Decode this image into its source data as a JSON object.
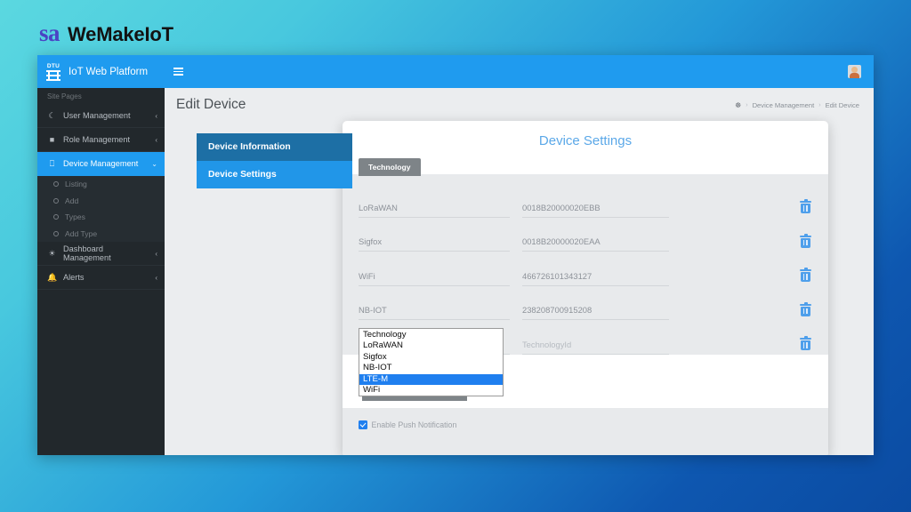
{
  "brand": {
    "prefix": "sa",
    "name": "WeMakeIoT"
  },
  "sidebar": {
    "logo_text": "DTU",
    "title": "IoT Web Platform",
    "section_label": "Site Pages",
    "items": [
      {
        "label": "User Management",
        "icon": "user-icon",
        "glyph": "●",
        "caret": "‹",
        "active": false
      },
      {
        "label": "Role Management",
        "icon": "id-card-icon",
        "glyph": "■",
        "caret": "‹",
        "active": false
      },
      {
        "label": "Device Management",
        "icon": "monitor-icon",
        "glyph": "▭",
        "caret": "⌄",
        "active": true
      },
      {
        "label": "Dashboard Management",
        "icon": "dashboard-icon",
        "glyph": "◔",
        "caret": "‹",
        "active": false
      },
      {
        "label": "Alerts",
        "icon": "bell-icon",
        "glyph": "▲",
        "caret": "‹",
        "active": false
      }
    ],
    "sub_items": [
      {
        "label": "Listing"
      },
      {
        "label": "Add"
      },
      {
        "label": "Types"
      },
      {
        "label": "Add Type"
      }
    ]
  },
  "topbar": {
    "menu_icon": "hamburger-icon",
    "avatar_icon": "user-avatar-icon"
  },
  "page": {
    "title": "Edit Device",
    "breadcrumb": {
      "home_icon": "dashboard-icon",
      "items": [
        "Device Management",
        "Edit Device"
      ],
      "separator": "›"
    }
  },
  "tabs": [
    {
      "label": "Device Information",
      "active": false
    },
    {
      "label": "Device Settings",
      "active": true
    }
  ],
  "card": {
    "title": "Device Settings",
    "tech_tab": "Technology",
    "rows": [
      {
        "name": "LoRaWAN",
        "value": "0018B20000020EBB",
        "is_placeholder": false,
        "delete_icon": "trash-icon"
      },
      {
        "name": "Sigfox",
        "value": "0018B20000020EAA",
        "is_placeholder": false,
        "delete_icon": "trash-icon"
      },
      {
        "name": "WiFi",
        "value": "466726101343127",
        "is_placeholder": false,
        "delete_icon": "trash-icon"
      },
      {
        "name": "NB-IOT",
        "value": "238208700915208",
        "is_placeholder": false,
        "delete_icon": "trash-icon"
      },
      {
        "name": "Technology",
        "value": "TechnologyId",
        "is_placeholder": true,
        "delete_icon": "trash-icon"
      }
    ],
    "dropdown": {
      "open": true,
      "options": [
        "Technology",
        "LoRaWAN",
        "Sigfox",
        "NB-IOT",
        "LTE-M",
        "WiFi"
      ],
      "selected": "LTE-M"
    },
    "push_notification": {
      "label": "Enable Push Notification",
      "checked": true
    }
  },
  "colors": {
    "accent_blue": "#1F9BEF",
    "tab_active": "#2196E8",
    "tab_inactive": "#1D6FA5",
    "sidebar_bg": "#22282C",
    "card_title": "#5BA8E8",
    "trash_icon": "#4E9FEB",
    "dropdown_highlight": "#1F7FEF",
    "tech_tab_bg": "#7E8488"
  }
}
